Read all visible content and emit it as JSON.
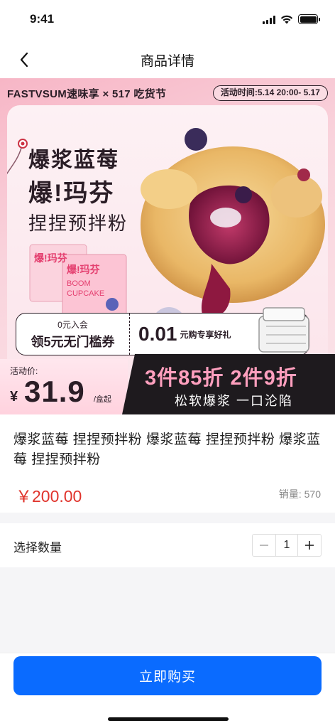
{
  "status_bar": {
    "time": "9:41"
  },
  "nav": {
    "title": "商品详情",
    "back_icon": "chevron-left-icon"
  },
  "banner": {
    "brand": "FASTVSUM速味享 × 517 吃货节",
    "event_time": "活动时间:5.14  20:00- 5.17",
    "headline_1": "爆浆蓝莓",
    "headline_2": "爆!玛芬",
    "headline_3": "捏捏预拌粉",
    "box_text_1": "爆!玛芬",
    "box_text_2": "BOOM",
    "box_text_3": "CUPCAKE",
    "coupon_small": "0元入会",
    "coupon_big": "领5元无门槛券",
    "coupon_price": "0.01",
    "coupon_desc": "元购专享好礼",
    "promo_label": "活动价:",
    "promo_currency": "¥",
    "promo_price": "31.9",
    "promo_unit": "/盒起",
    "deal_text": "3件85折 2件9折",
    "deal_sub": "松软爆浆 一口沦陷",
    "colors": {
      "pink": "#f7b6c6",
      "dark": "#1e1a1e",
      "accent_pink": "#ff9fbe"
    }
  },
  "product": {
    "title": "爆浆蓝莓 捏捏预拌粉 爆浆蓝莓 捏捏预拌粉 爆浆蓝莓 捏捏预拌粉",
    "price": "￥200.00",
    "sales_label": "销量:",
    "sales_count": "570",
    "price_color": "#e0342c"
  },
  "quantity": {
    "label": "选择数量",
    "value": "1",
    "minus_icon": "minus-icon",
    "plus_icon": "plus-icon"
  },
  "action": {
    "buy_label": "立即购买",
    "color": "#0a6bff"
  }
}
